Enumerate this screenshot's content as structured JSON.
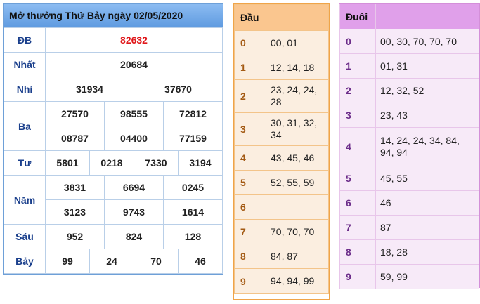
{
  "results": {
    "title": "Mở thưởng Thứ Bảy ngày 02/05/2020",
    "rows": [
      {
        "label": "ĐB",
        "numbers": [
          "82632"
        ]
      },
      {
        "label": "Nhất",
        "numbers": [
          "20684"
        ]
      },
      {
        "label": "Nhì",
        "numbers": [
          "31934",
          "37670"
        ]
      },
      {
        "label": "Ba",
        "numbers": [
          "27570",
          "98555",
          "72812",
          "08787",
          "04400",
          "77159"
        ]
      },
      {
        "label": "Tư",
        "numbers": [
          "5801",
          "0218",
          "7330",
          "3194"
        ]
      },
      {
        "label": "Năm",
        "numbers": [
          "3831",
          "6694",
          "0245",
          "3123",
          "9743",
          "1614"
        ]
      },
      {
        "label": "Sáu",
        "numbers": [
          "952",
          "824",
          "128"
        ]
      },
      {
        "label": "Bảy",
        "numbers": [
          "99",
          "24",
          "70",
          "46"
        ]
      }
    ]
  },
  "dau": {
    "title": "Đầu",
    "rows": [
      {
        "key": "0",
        "values": "00, 01"
      },
      {
        "key": "1",
        "values": "12, 14, 18"
      },
      {
        "key": "2",
        "values": "23, 24, 24, 28"
      },
      {
        "key": "3",
        "values": "30, 31, 32, 34"
      },
      {
        "key": "4",
        "values": "43, 45, 46"
      },
      {
        "key": "5",
        "values": "52, 55, 59"
      },
      {
        "key": "6",
        "values": ""
      },
      {
        "key": "7",
        "values": "70, 70, 70"
      },
      {
        "key": "8",
        "values": "84, 87"
      },
      {
        "key": "9",
        "values": "94, 94, 99"
      }
    ]
  },
  "duoi": {
    "title": "Đuôi",
    "rows": [
      {
        "key": "0",
        "values": "00, 30, 70, 70, 70"
      },
      {
        "key": "1",
        "values": "01, 31"
      },
      {
        "key": "2",
        "values": "12, 32, 52"
      },
      {
        "key": "3",
        "values": "23, 43"
      },
      {
        "key": "4",
        "values": "14, 24, 24, 34, 84, 94, 94"
      },
      {
        "key": "5",
        "values": "45, 55"
      },
      {
        "key": "6",
        "values": "46"
      },
      {
        "key": "7",
        "values": "87"
      },
      {
        "key": "8",
        "values": "18, 28"
      },
      {
        "key": "9",
        "values": "59, 99"
      }
    ]
  },
  "colors": {
    "special_prize": "#e0181b",
    "prize_label": "#1a3f8c",
    "dau_accent": "#f0a448",
    "duoi_accent": "#d48fd9"
  }
}
